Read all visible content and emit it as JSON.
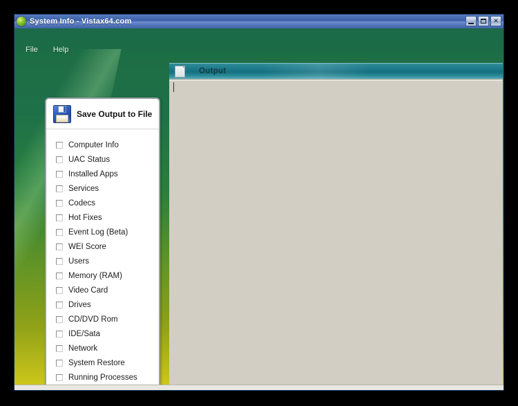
{
  "window": {
    "title": "System Info - Vistax64.com",
    "icon": "app-globe-icon",
    "controls": {
      "minimize": "minimize-button",
      "maximize": "maximize-button",
      "close": "✕"
    }
  },
  "menu": {
    "items": [
      {
        "label": "File"
      },
      {
        "label": "Help"
      }
    ]
  },
  "save_panel": {
    "icon": "floppy-disk-icon",
    "title": "Save Output to File",
    "checkboxes": [
      {
        "label": "Computer Info",
        "checked": false
      },
      {
        "label": "UAC Status",
        "checked": false
      },
      {
        "label": "Installed Apps",
        "checked": false
      },
      {
        "label": "Services",
        "checked": false
      },
      {
        "label": "Codecs",
        "checked": false
      },
      {
        "label": "Hot Fixes",
        "checked": false
      },
      {
        "label": "Event Log (Beta)",
        "checked": false
      },
      {
        "label": "WEI Score",
        "checked": false
      },
      {
        "label": "Users",
        "checked": false
      },
      {
        "label": "Memory (RAM)",
        "checked": false
      },
      {
        "label": "Video Card",
        "checked": false
      },
      {
        "label": "Drives",
        "checked": false
      },
      {
        "label": "CD/DVD Rom",
        "checked": false
      },
      {
        "label": "IDE/Sata",
        "checked": false
      },
      {
        "label": "Network",
        "checked": false
      },
      {
        "label": "System Restore",
        "checked": false
      },
      {
        "label": "Running Processes",
        "checked": false
      }
    ]
  },
  "output_panel": {
    "icon": "document-icon",
    "tab_label": "Output",
    "text": ""
  },
  "colors": {
    "titlebar_blue": "#3b5fa8",
    "wallpaper_green": "#1d7048",
    "wallpaper_yellow": "#d6cf24",
    "output_teal": "#15707f",
    "output_body": "#d3cec4",
    "panel_white": "#ffffff"
  }
}
